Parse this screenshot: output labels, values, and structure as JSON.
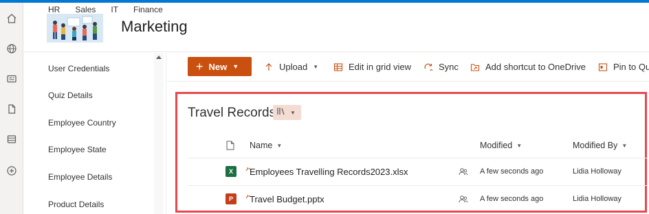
{
  "hub_nav": [
    "HR",
    "Sales",
    "IT",
    "Finance"
  ],
  "site": {
    "title": "Marketing"
  },
  "left_nav": {
    "items": [
      "User Credentials",
      "Quiz Details",
      "Employee Country",
      "Employee State",
      "Employee Details",
      "Product Details"
    ]
  },
  "command_bar": {
    "new_label": "New",
    "upload_label": "Upload",
    "grid_label": "Edit in grid view",
    "sync_label": "Sync",
    "shortcut_label": "Add shortcut to OneDrive",
    "pin_label": "Pin to Qu"
  },
  "library": {
    "title": "Travel Records",
    "columns": {
      "name": "Name",
      "modified": "Modified",
      "modified_by": "Modified By"
    },
    "rows": [
      {
        "name": "Employees Travelling Records2023.xlsx",
        "type": "excel-icon",
        "modified": "A few seconds ago",
        "modified_by": "Lidia Holloway"
      },
      {
        "name": "Travel Budget.pptx",
        "type": "powerpoint-icon",
        "modified": "A few seconds ago",
        "modified_by": "Lidia Holloway"
      }
    ]
  },
  "colors": {
    "accent": "#ca5010",
    "highlight": "#e8474c",
    "suite_bar": "#0078d4"
  }
}
